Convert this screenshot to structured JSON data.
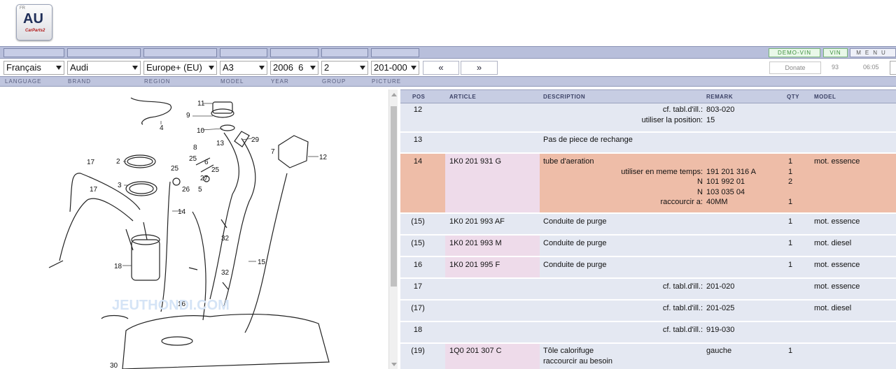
{
  "logo": {
    "text": "AU",
    "small": "FR",
    "brand": "CarParts2"
  },
  "top_buttons": {
    "demo_vin": "DEMO-VIN",
    "vin": "VIN",
    "menu": "MENU"
  },
  "selectors": {
    "language": "Français",
    "brand": "Audi",
    "region": "Europe+ (EU)",
    "model": "A3",
    "year": "2006  6",
    "group": "2",
    "picture": "201-000"
  },
  "nav": {
    "prev": "«",
    "next": "»"
  },
  "donate": "Donate",
  "counter": "93",
  "time": "06:05",
  "labels": {
    "language": "LANGUAGE",
    "brand": "BRAND",
    "region": "REGION",
    "model": "MODEL",
    "year": "YEAR",
    "group": "GROUP",
    "picture": "PICTURE"
  },
  "table": {
    "headers": {
      "pos": "POS",
      "article": "ARTICLE",
      "description": "DESCRIPTION",
      "remark": "REMARK",
      "qty": "QTY",
      "model": "MODEL"
    },
    "rows": [
      {
        "pos": "12",
        "lines": [
          {
            "left": "cf. tabl.d'ill.:",
            "rem": "803-020"
          },
          {
            "left": "utiliser la position:",
            "rem": "15"
          }
        ]
      },
      {
        "pos": "13",
        "desc": "Pas de piece de rechange"
      },
      {
        "pos": "14",
        "article": "1K0 201 931 G",
        "desc": "tube d'aeration",
        "qty": "1",
        "model": "mot. essence",
        "lines": [
          {
            "left": "utiliser en meme temps:",
            "rem": "191 201 316 A",
            "qty": "1"
          },
          {
            "left": "N",
            "rem": "101 992 01",
            "qty": "2"
          },
          {
            "left": "N",
            "rem": "103 035 04",
            "qty": ""
          },
          {
            "left": "raccourcir a:",
            "rem": "40MM",
            "qty": "1"
          }
        ]
      },
      {
        "pos": "(15)",
        "article": "1K0 201 993 AF",
        "desc": "Conduite de purge",
        "qty": "1",
        "model": "mot. essence"
      },
      {
        "pos": "(15)",
        "article": "1K0 201 993 M",
        "desc": "Conduite de purge",
        "qty": "1",
        "model": "mot. diesel"
      },
      {
        "pos": "16",
        "article": "1K0 201 995 F",
        "desc": "Conduite de purge",
        "qty": "1",
        "model": "mot. essence"
      },
      {
        "pos": "17",
        "lines": [
          {
            "left": "cf. tabl.d'ill.:",
            "rem": "201-020"
          }
        ],
        "model": "mot. essence"
      },
      {
        "pos": "(17)",
        "lines": [
          {
            "left": "cf. tabl.d'ill.:",
            "rem": "201-025"
          }
        ],
        "model": "mot. diesel"
      },
      {
        "pos": "18",
        "lines": [
          {
            "left": "cf. tabl.d'ill.:",
            "rem": "919-030"
          }
        ]
      },
      {
        "pos": "(19)",
        "article": "1Q0 201 307 C",
        "desc": "Tôle calorifuge",
        "desc2": "raccourcir au besoin",
        "rem": "gauche",
        "qty": "1"
      }
    ]
  },
  "diagram": {
    "callouts": [
      "4",
      "2",
      "3",
      "17",
      "17",
      "18",
      "14",
      "26",
      "25",
      "25",
      "27",
      "5",
      "8",
      "6",
      "25",
      "13",
      "11",
      "9",
      "10",
      "29",
      "7",
      "12",
      "32",
      "32",
      "15",
      "16",
      "30"
    ],
    "watermark": "JEUTHONDI.COM"
  }
}
